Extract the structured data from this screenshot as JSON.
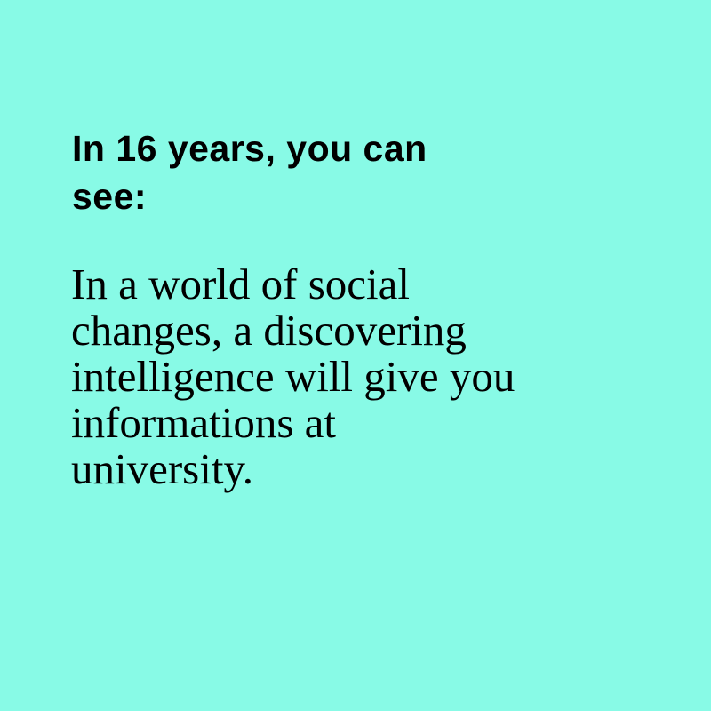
{
  "colors": {
    "background": "#88FAE6",
    "text": "#000000"
  },
  "heading": {
    "lines": [
      "In 16 years, you can",
      "see:"
    ]
  },
  "body": {
    "lines": [
      "In a world of social",
      "changes, a discovering",
      "intelligence will give you",
      "informations at",
      "university."
    ]
  }
}
